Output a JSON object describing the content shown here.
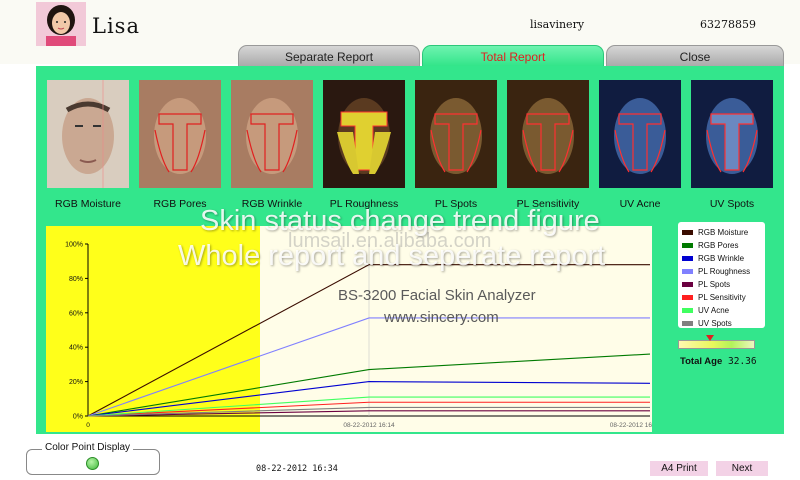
{
  "header": {
    "user_name": "Lisa",
    "account": "lisavinery",
    "phone": "63278859"
  },
  "tabs": [
    {
      "label": "Separate Report"
    },
    {
      "label": "Total Report"
    },
    {
      "label": "Close"
    }
  ],
  "thumbnails": [
    {
      "label": "RGB Moisture"
    },
    {
      "label": "RGB Pores"
    },
    {
      "label": "RGB Wrinkle"
    },
    {
      "label": "PL Roughness"
    },
    {
      "label": "PL Spots"
    },
    {
      "label": "PL Sensitivity"
    },
    {
      "label": "UV Acne"
    },
    {
      "label": "UV Spots"
    }
  ],
  "overlay": {
    "title_line1": "Skin status change trend figure",
    "title_line2": "Whole report and seperate report",
    "site": "lumsail.en.alibaba.com",
    "product": "BS-3200 Facial Skin Analyzer",
    "url": "www.sincery.com"
  },
  "total_age": {
    "label": "Total Age",
    "value": "32.36"
  },
  "footer": {
    "color_point_label": "Color Point Display",
    "timestamp": "08-22-2012 16:34",
    "print_label": "A4 Print",
    "next_label": "Next"
  },
  "chart_data": {
    "type": "line",
    "title": "",
    "xlabel": "",
    "ylabel": "",
    "ylim": [
      0,
      100
    ],
    "y_ticks": [
      "0%",
      "20%",
      "40%",
      "60%",
      "80%",
      "100%"
    ],
    "x_ticks": [
      "0",
      "08-22-2012 16:14",
      "08-22-2012 16"
    ],
    "grid": false,
    "x_points": 3,
    "series": [
      {
        "name": "RGB Moisture",
        "color": "#3a0c00",
        "values": [
          0,
          88,
          88
        ]
      },
      {
        "name": "RGB Pores",
        "color": "#007a00",
        "values": [
          0,
          27,
          36
        ]
      },
      {
        "name": "RGB Wrinkle",
        "color": "#0000d0",
        "values": [
          0,
          20,
          19
        ]
      },
      {
        "name": "PL Roughness",
        "color": "#8080ff",
        "values": [
          0,
          57,
          57
        ]
      },
      {
        "name": "PL Spots",
        "color": "#6b0040",
        "values": [
          0,
          3,
          3
        ]
      },
      {
        "name": "PL Sensitivity",
        "color": "#ff2020",
        "values": [
          0,
          8,
          8
        ]
      },
      {
        "name": "UV Acne",
        "color": "#40ff60",
        "values": [
          0,
          11,
          11
        ]
      },
      {
        "name": "UV Spots",
        "color": "#808080",
        "values": [
          0,
          5,
          5
        ]
      }
    ]
  }
}
